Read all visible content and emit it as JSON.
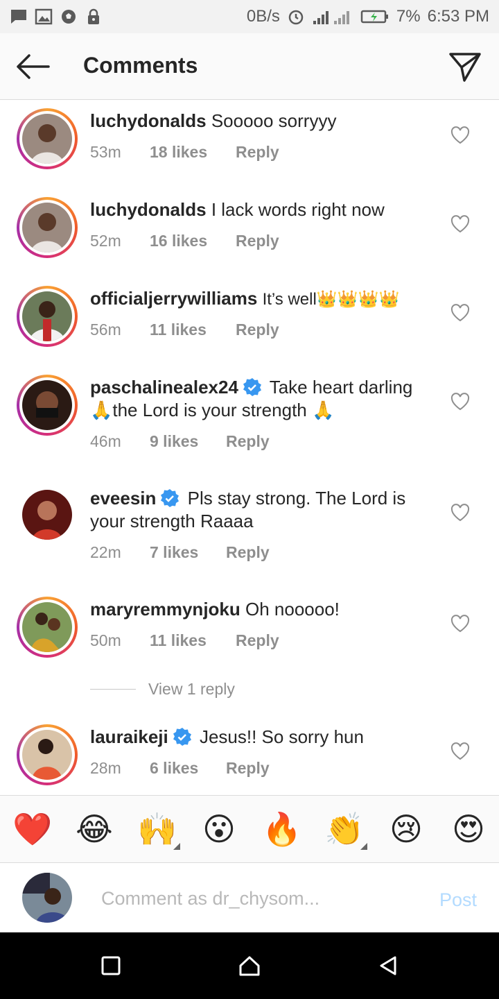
{
  "status_bar": {
    "speed": "0B/s",
    "battery": "7%",
    "time": "6:53 PM"
  },
  "header": {
    "title": "Comments"
  },
  "comments": [
    {
      "username": "luchydonalds",
      "verified": false,
      "text": "Sooooo sorryyy",
      "time": "53m",
      "likes": "18 likes",
      "reply": "Reply"
    },
    {
      "username": "luchydonalds",
      "verified": false,
      "text": "I lack words right now",
      "time": "52m",
      "likes": "16 likes",
      "reply": "Reply"
    },
    {
      "username": "officialjerrywilliams",
      "verified": false,
      "text": "It’s well👑👑👑👑",
      "time": "56m",
      "likes": "11 likes",
      "reply": "Reply"
    },
    {
      "username": "paschalinealex24",
      "verified": true,
      "text": "Take heart darling 🙏the Lord is your strength 🙏",
      "time": "46m",
      "likes": "9 likes",
      "reply": "Reply"
    },
    {
      "username": "eveesin",
      "verified": true,
      "text": "Pls stay strong. The Lord is your strength Raaaa",
      "time": "22m",
      "likes": "7 likes",
      "reply": "Reply"
    },
    {
      "username": "maryremmynjoku",
      "verified": false,
      "text": "Oh nooooo!",
      "time": "50m",
      "likes": "11 likes",
      "reply": "Reply"
    },
    {
      "username": "lauraikeji",
      "verified": true,
      "text": "Jesus!! So sorry hun",
      "time": "28m",
      "likes": "6 likes",
      "reply": "Reply"
    }
  ],
  "view_replies": "View 1 reply",
  "emoji_bar": [
    "❤️",
    "😂",
    "🙌",
    "😮",
    "🔥",
    "👏",
    "😢",
    "😍"
  ],
  "composer": {
    "placeholder": "Comment as dr_chysom...",
    "post_label": "Post"
  },
  "icons": {
    "back": "back-arrow-icon",
    "send": "direct-send-icon",
    "heart": "heart-outline-icon",
    "verified": "verified-badge-icon"
  },
  "colors": {
    "accent_blue": "#3897f0",
    "post_disabled": "#b3dbff",
    "meta_gray": "#8e8e8e"
  }
}
